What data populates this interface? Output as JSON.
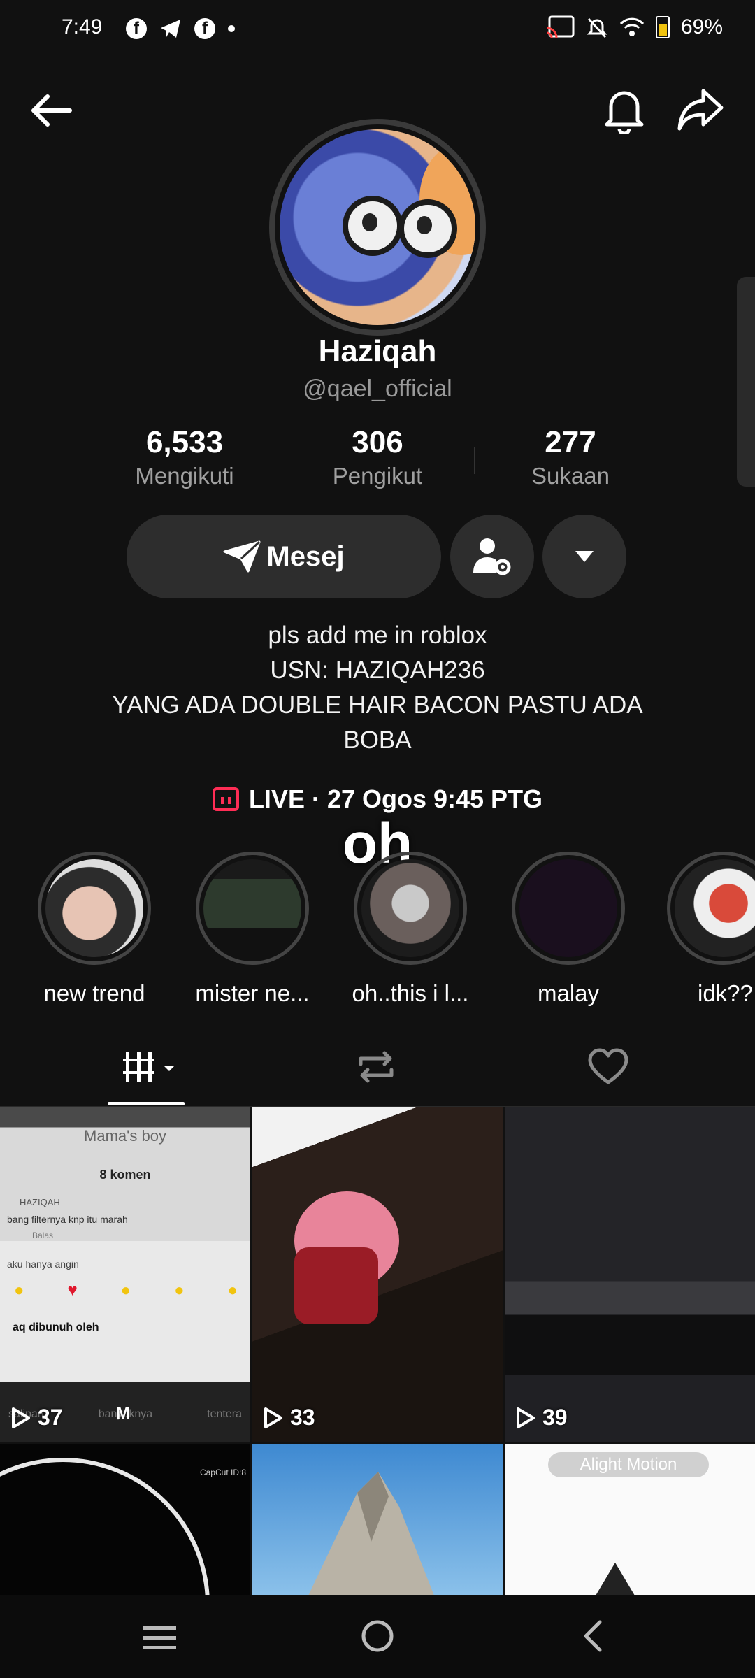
{
  "status_bar": {
    "time": "7:49",
    "battery": "69%",
    "left_icons": [
      "facebook-icon",
      "telegram-icon",
      "facebook-icon",
      "dot-icon"
    ],
    "right_icons": [
      "cast-icon",
      "mute-icon",
      "wifi-icon",
      "battery-icon"
    ]
  },
  "profile": {
    "name": "Haziqah",
    "handle": "@qael_official",
    "stats": [
      {
        "value": "6,533",
        "label": "Mengikuti"
      },
      {
        "value": "306",
        "label": "Pengikut"
      },
      {
        "value": "277",
        "label": "Sukaan"
      }
    ],
    "message_button": "Mesej",
    "bio": [
      "pls add me in roblox",
      "USN: HAZIQAH236",
      "YANG ADA DOUBLE HAIR BACON PASTU ADA",
      "BOBA"
    ],
    "live": "LIVE · 27 Ogos 9:45 PTG",
    "overlay_text": "oh"
  },
  "highlights": [
    {
      "label": "new trend"
    },
    {
      "label": "mister ne..."
    },
    {
      "label": "oh..this i l..."
    },
    {
      "label": "malay"
    },
    {
      "label": "idk??"
    }
  ],
  "tabs": [
    "videos-tab-icon",
    "repost-tab-icon",
    "liked-tab-icon"
  ],
  "videos": [
    {
      "views": "37",
      "thumb_texts": {
        "title": "Mama's boy",
        "comments": "8 komen",
        "commenter": "HAZIQAH",
        "comment": "bang filternya knp itu marah",
        "reply": "Balas",
        "line2": "aku hanya angin",
        "input": "aq dibunuh oleh",
        "bottom_left": "salipan",
        "bottom_mid": "banyaknya",
        "bottom_right": "tentera",
        "overlay_letter": "M"
      }
    },
    {
      "views": "33"
    },
    {
      "views": "39"
    },
    {
      "thumb_texts": {
        "watermark": "CapCut ID:8"
      }
    },
    {},
    {
      "thumb_texts": {
        "watermark": "Alight Motion"
      }
    }
  ],
  "colors": {
    "background": "#111111",
    "button_bg": "#2d2d2d",
    "live_accent": "#ff2d55",
    "muted_text": "#a0a0a0"
  }
}
